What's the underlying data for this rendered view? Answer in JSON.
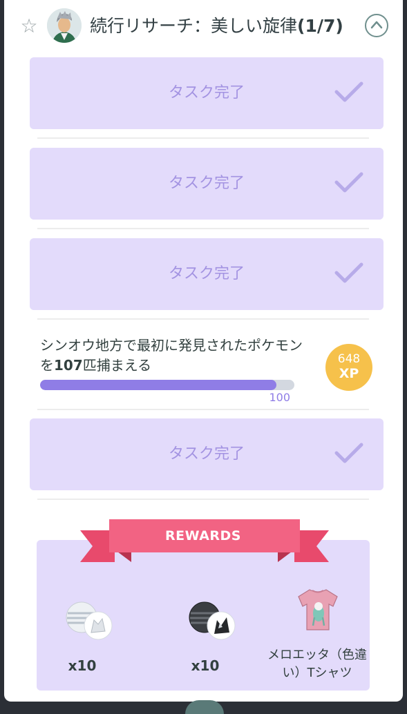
{
  "header": {
    "title": "続行リサーチ：美しい旋律",
    "progress": "(1/7)",
    "star_icon": "star-outline-icon",
    "collapse_icon": "chevron-up-icon"
  },
  "tasks": [
    {
      "label": "タスク完了"
    },
    {
      "label": "タスク完了"
    },
    {
      "label": "タスク完了"
    },
    {
      "label": "タスク完了"
    }
  ],
  "active_task": {
    "text_before": "シンオウ地方で最初に発見されたポケモンを",
    "text_bold": "107",
    "text_after": "匹捕まえる",
    "progress_value": 100,
    "progress_fraction": 0.93,
    "progress_label": "100",
    "xp_amount": "648",
    "xp_unit": "XP"
  },
  "rewards": {
    "title": "REWARDS",
    "items": [
      {
        "icon": "silver-ball-with-pokemon-icon",
        "label": "x10"
      },
      {
        "icon": "dark-ball-with-pokemon-icon",
        "label": "x10"
      },
      {
        "icon": "pink-tshirt-icon",
        "label": "メロエッタ（色違い）Tシャツ"
      }
    ]
  },
  "colors": {
    "task_bg": "#e3dbfb",
    "task_text": "#a393e2",
    "progress": "#8f7de6",
    "xp_badge": "#f6c14b",
    "ribbon": "#f05d7e"
  }
}
